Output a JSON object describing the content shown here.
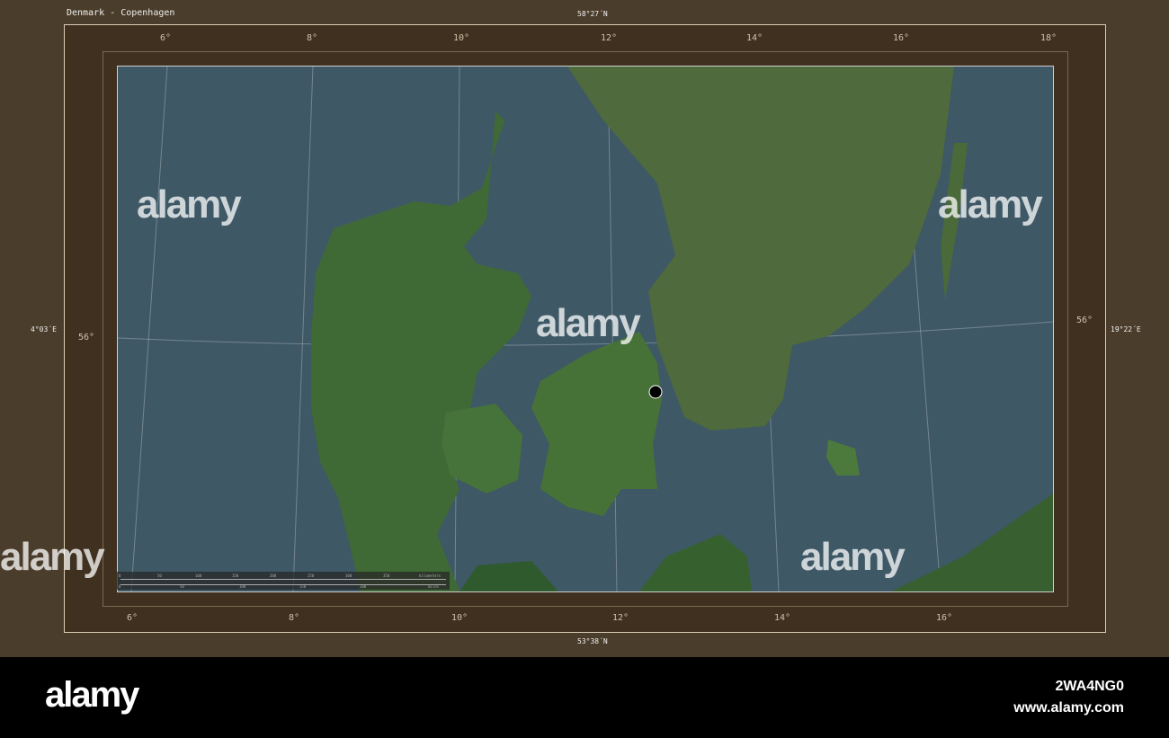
{
  "title": "Denmark - Copenhagen",
  "bounds": {
    "north": "58°27´N",
    "south": "53°38´N",
    "west": "4°03´E",
    "east": "19°22´E"
  },
  "top_lon_ticks": [
    "6°",
    "8°",
    "10°",
    "12°",
    "14°",
    "16°",
    "18°"
  ],
  "bottom_lon_ticks": [
    "6°",
    "8°",
    "10°",
    "12°",
    "14°",
    "16°"
  ],
  "lat_ticks": {
    "left": "56°",
    "right": "56°"
  },
  "scale_bar": {
    "km_labels": [
      "0",
      "50",
      "100",
      "150",
      "200",
      "250",
      "300",
      "350"
    ],
    "km_unit": "kilometers",
    "mi_labels": [
      "0",
      "50",
      "100",
      "150",
      "200"
    ],
    "mi_unit": "miles"
  },
  "marker": {
    "city": "Copenhagen",
    "color": "#000000"
  },
  "watermark": "alamy",
  "footer": {
    "logo": "alamy",
    "image_id": "2WA4NG0",
    "site": "www.alamy.com"
  }
}
